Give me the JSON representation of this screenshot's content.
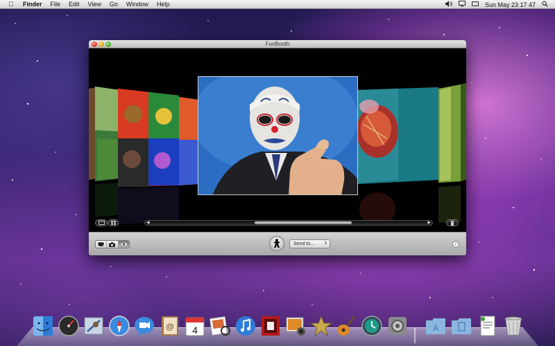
{
  "menubar": {
    "apple_icon": "apple-icon",
    "app_name": "Finder",
    "menus": [
      "File",
      "Edit",
      "View",
      "Go",
      "Window",
      "Help"
    ],
    "status_icons": [
      "volume-icon",
      "display-icon",
      "search-icon"
    ],
    "clock": "Sun May 23  17 47"
  },
  "window": {
    "title": "FunBooth",
    "bottombar": {
      "modes": [
        "mask-mode-icon",
        "camera-mode-icon",
        "eye-mode-icon"
      ],
      "send_to": "Send to...",
      "info_label": "i"
    }
  },
  "dock": {
    "apps": [
      "Finder",
      "Dashboard",
      "Mail",
      "Safari",
      "iChat",
      "Address Book",
      "iCal",
      "Preview",
      "iTunes",
      "Photo Booth",
      "iPhoto",
      "iMovie",
      "GarageBand",
      "Time Machine",
      "System Preferences"
    ],
    "stacks": [
      "Applications",
      "Documents",
      "Downloads",
      "Trash"
    ],
    "ical_day": "4"
  },
  "colors": {
    "accent": "#3f86d8",
    "desktop": "#5d2f8e"
  }
}
